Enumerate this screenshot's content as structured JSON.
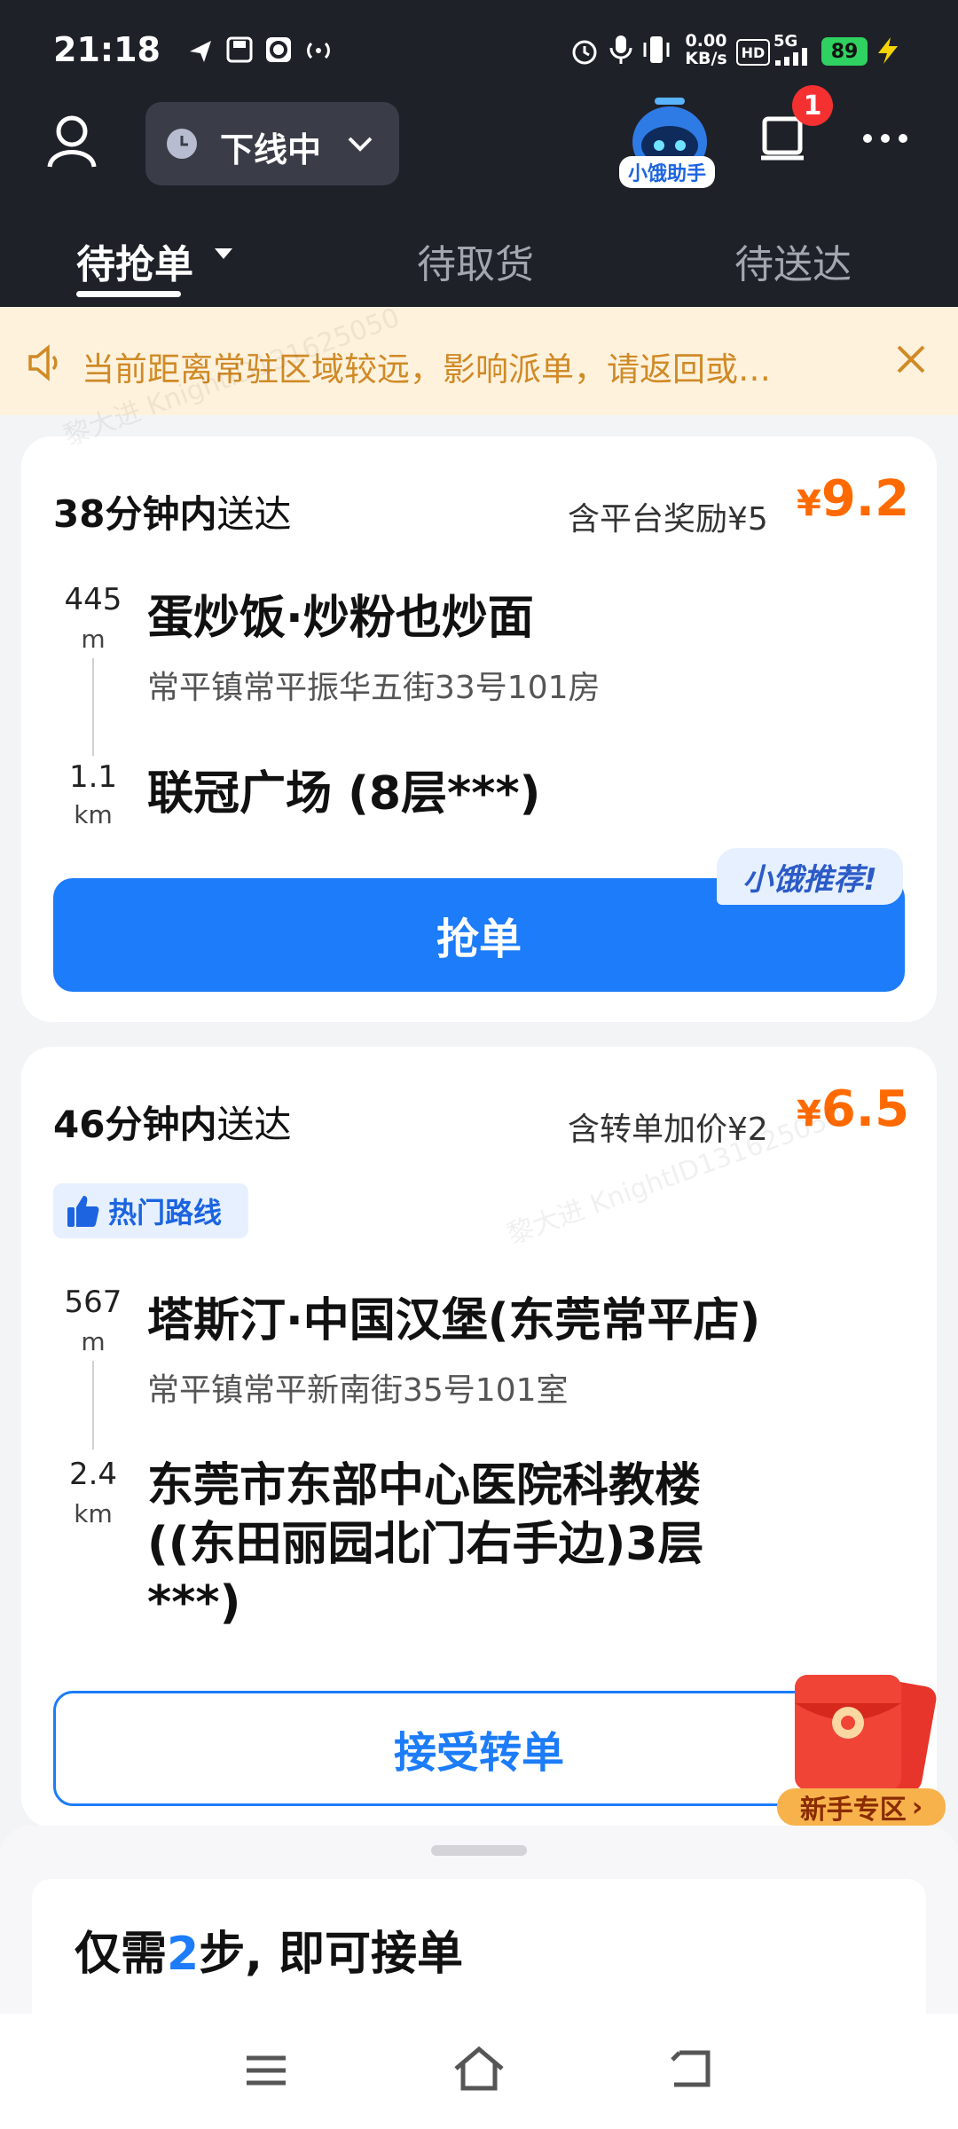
{
  "status_bar": {
    "time": "21:18",
    "net_speed_value": "0.00",
    "net_speed_unit": "KB/s",
    "hd": "HD",
    "signal": "5G",
    "battery": "89"
  },
  "header": {
    "status_pill_label": "下线中",
    "assistant_label": "小饿助手",
    "notification_count": "1"
  },
  "tabs": [
    {
      "label": "待抢单",
      "active": true
    },
    {
      "label": "待取货",
      "active": false
    },
    {
      "label": "待送达",
      "active": false
    }
  ],
  "notice": {
    "text": "当前距离常驻区域较远，影响派单，请返回或…"
  },
  "orders": [
    {
      "deliver_minutes": "38分钟内",
      "deliver_suffix": "送达",
      "bonus_text": "含平台奖励¥5",
      "currency": "¥",
      "price": "9.2",
      "pickup_distance_value": "445",
      "pickup_distance_unit": "m",
      "shop_name": "蛋炒饭·炒粉也炒面",
      "shop_address": "常平镇常平振华五街33号101房",
      "dropoff_distance_value": "1.1",
      "dropoff_distance_unit": "km",
      "dropoff_name": "联冠广场 (8层***)",
      "recommend_badge": "小饿推荐!",
      "action_label": "抢单"
    },
    {
      "deliver_minutes": "46分钟内",
      "deliver_suffix": "送达",
      "bonus_text": "含转单加价¥2",
      "currency": "¥",
      "price": "6.5",
      "tag": "热门路线",
      "pickup_distance_value": "567",
      "pickup_distance_unit": "m",
      "shop_name": "塔斯汀·中国汉堡(东莞常平店)",
      "shop_address": "常平镇常平新南街35号101室",
      "dropoff_distance_value": "2.4",
      "dropoff_distance_unit": "km",
      "dropoff_line1": "东莞市东部中心医院科教楼",
      "dropoff_line2": "((东田丽园北门右手边)3层",
      "dropoff_line3": "***)",
      "action_label": "接受转单"
    }
  ],
  "newbie_zone": {
    "label": "新手专区"
  },
  "sheet": {
    "title_prefix": "仅需",
    "title_number": "2",
    "title_suffix": "步, 即可接单"
  },
  "watermark": {
    "text": "黎大进 KnightID131625050"
  },
  "colors": {
    "header_bg": "#1F2129",
    "accent_blue": "#1C7CF9",
    "price_orange": "#FF6A00",
    "notice_bg": "#FEF2DD",
    "notice_text": "#D08A26"
  }
}
